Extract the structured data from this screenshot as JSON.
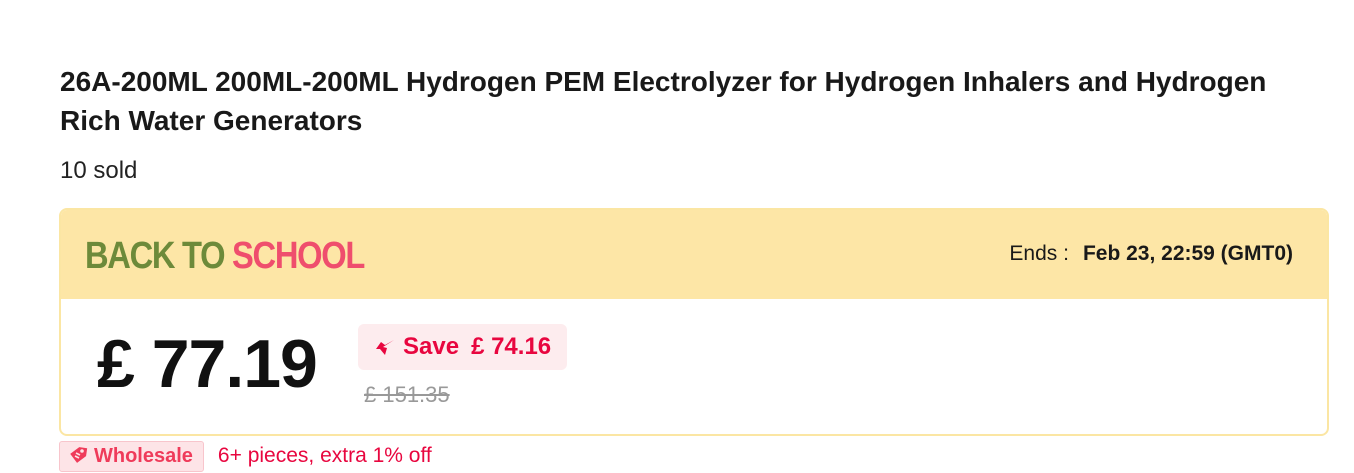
{
  "product": {
    "title": "26A-200ML 200ML-200ML Hydrogen PEM Electrolyzer for Hydrogen Inhalers and Hydrogen Rich Water Generators",
    "sold": "10 sold"
  },
  "promo": {
    "title_part1": "BACK TO ",
    "title_part2": "SCHOOL",
    "ends_label": "Ends :",
    "ends_date": "Feb 23, 22:59 (GMT0)",
    "colors": {
      "header_bg": "#fde6a6",
      "back_color": "#6d8a3a",
      "school_color": "#ef4e6d"
    }
  },
  "pricing": {
    "price": "£ 77.19",
    "save_label": "Save",
    "save_amount": "£ 74.16",
    "original_price": "£ 151.35",
    "save_icon": "down-arrow-icon",
    "accent_color": "#e8063f"
  },
  "wholesale": {
    "badge_label": "Wholesale",
    "badge_icon": "tag-icon",
    "text": "6+ pieces, extra 1% off"
  }
}
